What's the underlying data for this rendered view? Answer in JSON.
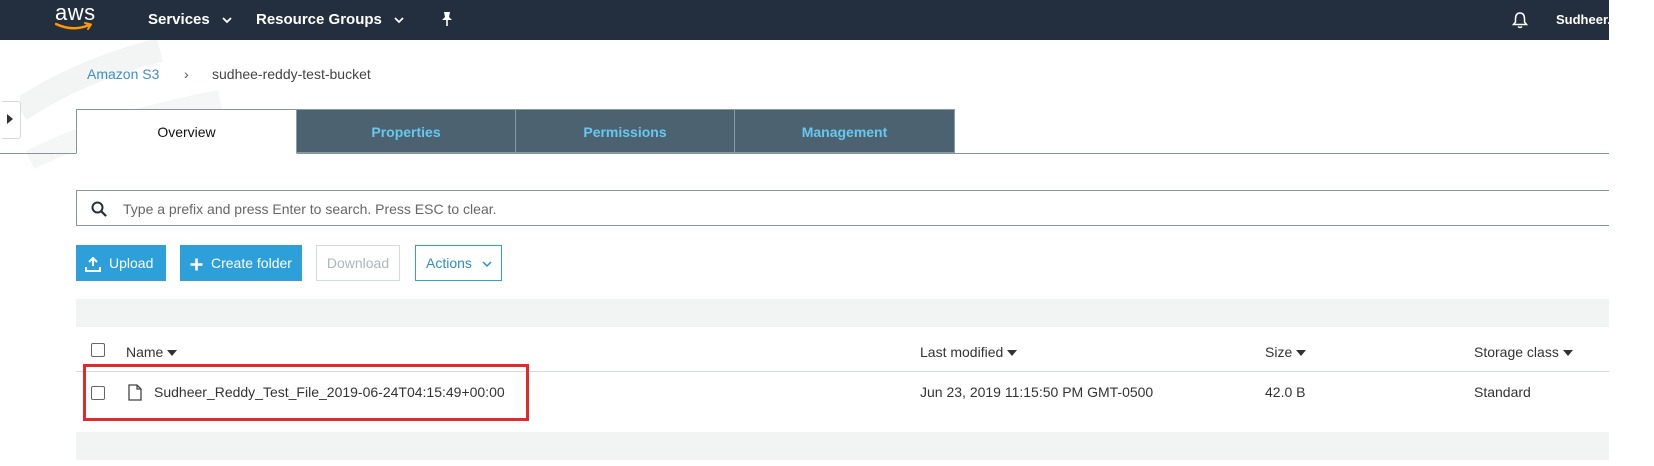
{
  "nav": {
    "logo_text": "aws",
    "services": "Services",
    "resource_groups": "Resource Groups",
    "user": "Sudheer."
  },
  "breadcrumb": {
    "root": "Amazon S3",
    "separator": "›",
    "current": "sudhee-reddy-test-bucket"
  },
  "tabs": [
    {
      "label": "Overview",
      "active": true
    },
    {
      "label": "Properties",
      "active": false
    },
    {
      "label": "Permissions",
      "active": false
    },
    {
      "label": "Management",
      "active": false
    }
  ],
  "search": {
    "placeholder": "Type a prefix and press Enter to search. Press ESC to clear."
  },
  "toolbar": {
    "upload": "Upload",
    "create_folder": "Create folder",
    "download": "Download",
    "actions": "Actions"
  },
  "table": {
    "headers": {
      "name": "Name",
      "last_modified": "Last modified",
      "size": "Size",
      "storage_class": "Storage class"
    },
    "rows": [
      {
        "name": "Sudheer_Reddy_Test_File_2019-06-24T04:15:49+00:00",
        "last_modified": "Jun 23, 2019 11:15:50 PM GMT-0500",
        "size": "42.0 B",
        "storage_class": "Standard",
        "checked": false
      }
    ]
  },
  "colors": {
    "nav_bg": "#232f3e",
    "primary": "#2d9fd9",
    "tab_inactive_bg": "#4d6270",
    "tab_inactive_text": "#66c8f0",
    "highlight": "#e02b2b"
  }
}
